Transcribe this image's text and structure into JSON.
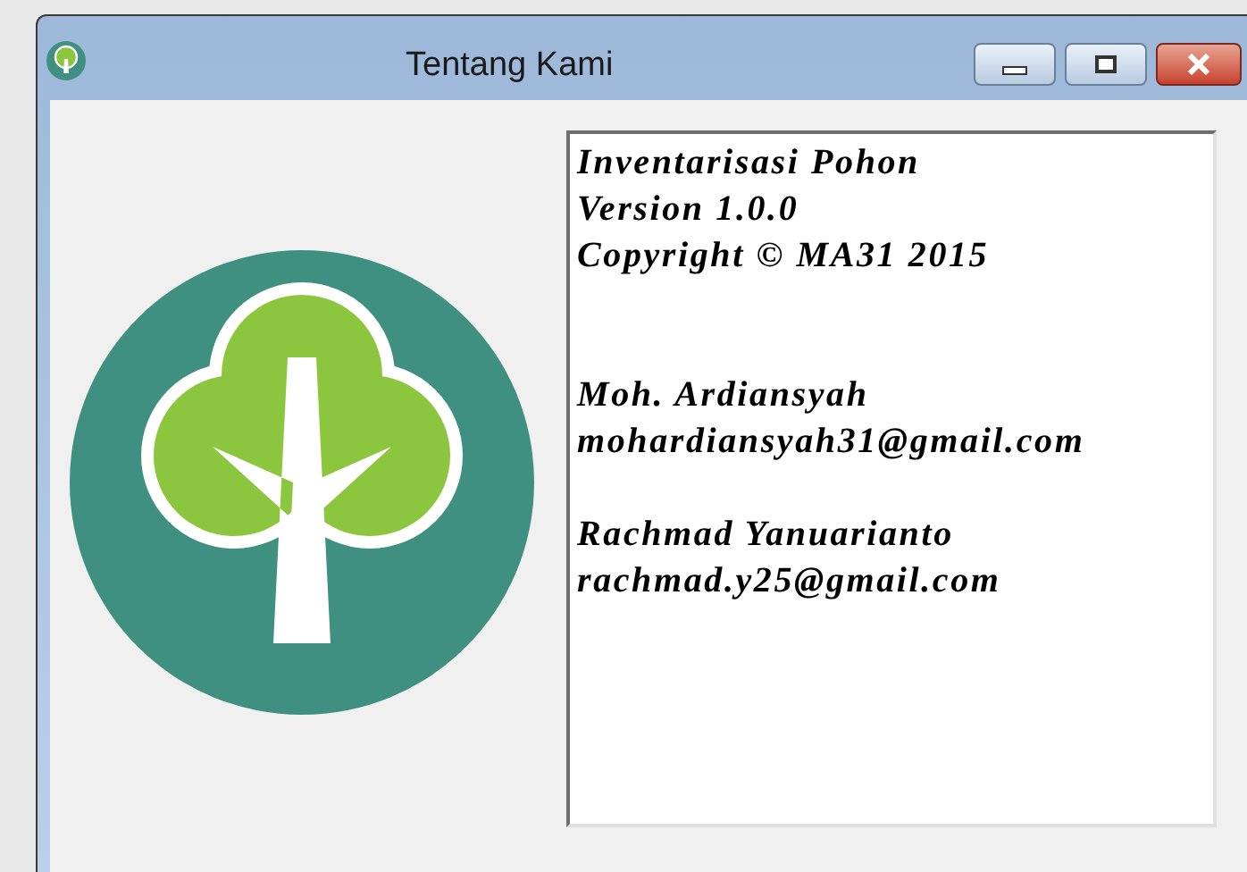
{
  "window": {
    "title": "Tentang Kami"
  },
  "about_text": {
    "blocks": [
      [
        "Inventarisasi Pohon",
        "Version 1.0.0",
        "Copyright © MA31 2015"
      ],
      [
        "Moh. Ardiansyah",
        "mohardiansyah31@gmail.com"
      ],
      [
        "Rachmad Yanuarianto",
        "rachmad.y25@gmail.com"
      ]
    ]
  }
}
